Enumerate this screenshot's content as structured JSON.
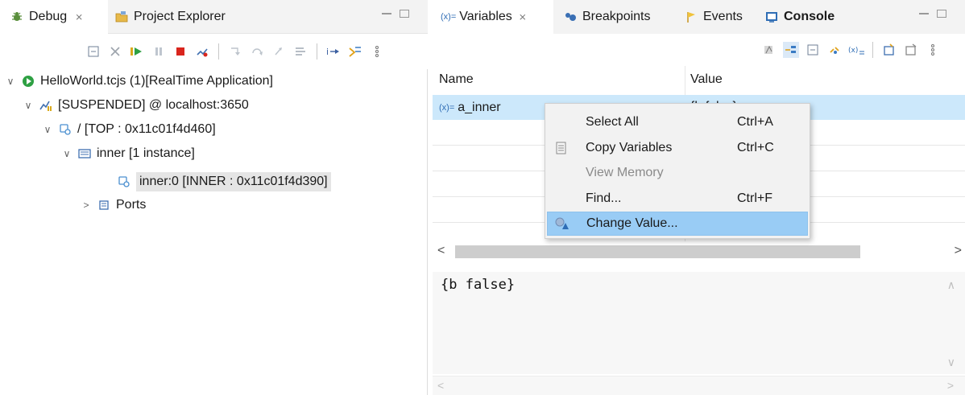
{
  "left_pane": {
    "tabs": [
      {
        "label": "Debug",
        "close": "⨯",
        "active": true
      },
      {
        "label": "Project Explorer",
        "active": false
      }
    ],
    "tree": [
      {
        "label": "HelloWorld.tcjs (1)[RealTime Application]",
        "expanded": true
      },
      {
        "label": "[SUSPENDED] @ localhost:3650",
        "expanded": true
      },
      {
        "label": "/ [TOP : 0x11c01f4d460]",
        "expanded": true
      },
      {
        "label": "inner [1 instance]",
        "expanded": true
      },
      {
        "label": "inner:0 [INNER : 0x11c01f4d390]",
        "selected": true
      },
      {
        "label": "Ports",
        "expanded": false
      }
    ]
  },
  "right_pane": {
    "tabs": [
      {
        "label": "Variables",
        "prefix": "(x)=",
        "close": "⨯",
        "active": true
      },
      {
        "label": "Breakpoints"
      },
      {
        "label": "Events"
      },
      {
        "label": "Console"
      }
    ],
    "table": {
      "col_name": "Name",
      "col_value": "Value",
      "rows": [
        {
          "name": "a_inner",
          "prefix": "(x)=",
          "value": "{b false}"
        }
      ]
    },
    "detail_text": "{b false}"
  },
  "context_menu": {
    "items": [
      {
        "label": "Select All",
        "shortcut": "Ctrl+A"
      },
      {
        "label": "Copy Variables",
        "shortcut": "Ctrl+C"
      },
      {
        "label": "View Memory",
        "shortcut": ""
      },
      {
        "label": "Find...",
        "shortcut": "Ctrl+F"
      },
      {
        "label": "Change Value...",
        "shortcut": ""
      }
    ]
  },
  "colors": {
    "selection": "#cce8fb",
    "menu_hover": "#99ccf5",
    "tabbar_bg": "#f3f3f3",
    "resume_green": "#2ea043",
    "terminate_red": "#d9251d",
    "accent_blue": "#1f6fb5"
  },
  "icons": {
    "debug_tab": "debug-bug-icon",
    "project_explorer_tab": "project-folder-icon",
    "app_root": "run-launch-icon",
    "suspended": "suspended-thread-icon",
    "instance": "instance-object-icon",
    "ports": "ports-icon",
    "breakpoints": "breakpoints-icon",
    "events": "events-flag-icon",
    "console": "console-icon"
  }
}
